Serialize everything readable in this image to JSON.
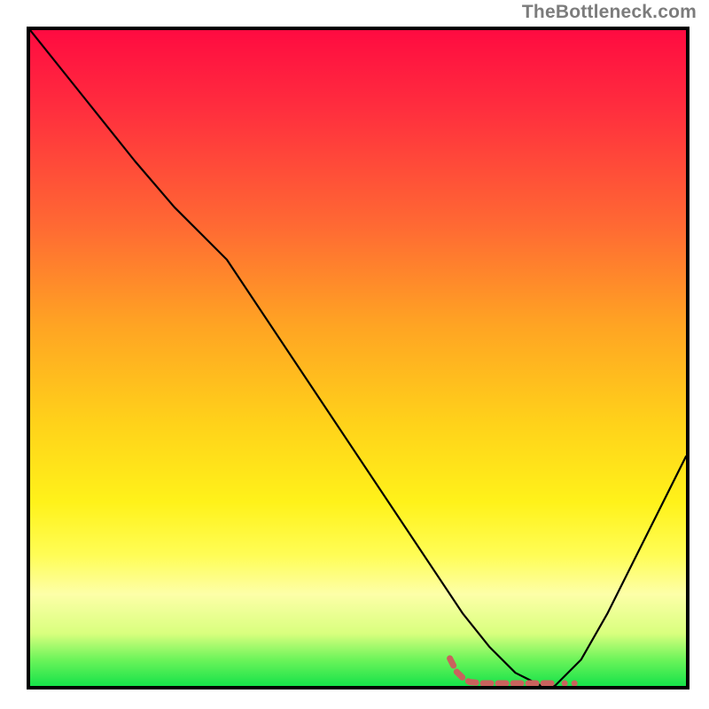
{
  "watermark": "TheBottleneck.com",
  "chart_data": {
    "type": "line",
    "title": "",
    "xlabel": "",
    "ylabel": "",
    "xlim": [
      0,
      100
    ],
    "ylim": [
      0,
      100
    ],
    "grid": false,
    "legend": false,
    "series": [
      {
        "name": "bottleneck-curve",
        "color": "#000000",
        "stroke_width": 2.2,
        "x": [
          0,
          8,
          16,
          22,
          26,
          30,
          40,
          50,
          60,
          66,
          70,
          74,
          78,
          80,
          84,
          88,
          92,
          96,
          100
        ],
        "y": [
          100,
          90,
          80,
          73,
          69,
          65,
          50,
          35,
          20,
          11,
          6,
          2,
          0,
          0,
          4,
          11,
          19,
          27,
          35
        ]
      }
    ],
    "annotations": [
      {
        "name": "optimal-marker",
        "type": "dotted-path",
        "color": "#c9625d",
        "stroke_width": 7,
        "points_x": [
          64,
          65,
          66,
          67,
          69,
          72,
          75,
          77,
          78.5,
          79.5
        ],
        "points_y": [
          4.2,
          2.2,
          1.2,
          0.6,
          0.4,
          0.4,
          0.4,
          0.4,
          0.4,
          0.4
        ]
      }
    ],
    "background_gradient_stops": [
      {
        "pct": 0,
        "color": "#ff0b41"
      },
      {
        "pct": 12,
        "color": "#ff2e3e"
      },
      {
        "pct": 30,
        "color": "#ff6a33"
      },
      {
        "pct": 45,
        "color": "#ffa423"
      },
      {
        "pct": 60,
        "color": "#ffd21a"
      },
      {
        "pct": 72,
        "color": "#fff21a"
      },
      {
        "pct": 80,
        "color": "#fffd55"
      },
      {
        "pct": 86,
        "color": "#fdffa8"
      },
      {
        "pct": 92,
        "color": "#d9ff7e"
      },
      {
        "pct": 96,
        "color": "#6cf45a"
      },
      {
        "pct": 100,
        "color": "#16e24a"
      }
    ]
  }
}
